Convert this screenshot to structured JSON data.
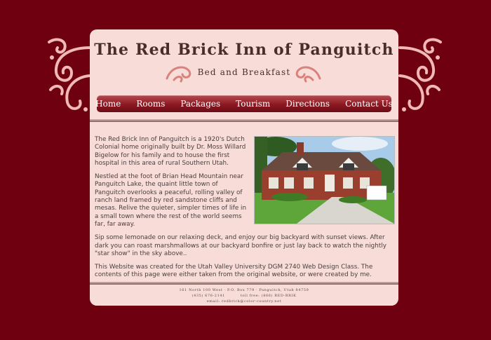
{
  "header": {
    "title": "The Red Brick Inn of Panguitch",
    "subtitle": "Bed and Breakfast"
  },
  "nav": {
    "items": [
      "Home",
      "Rooms",
      "Packages",
      "Tourism",
      "Directions",
      "Contact Us"
    ]
  },
  "main": {
    "paragraphs": [
      "The Red Brick Inn of Panguitch is a 1920's Dutch Colonial home originally built by Dr. Moss Willard Bigelow for his family and to house the first hospital in this area of rural Southern Utah.",
      "Nestled at the foot of Brian Head Mountain near Panguitch Lake, the quaint little town of Panguitch overlooks a peaceful, rolling valley of ranch land framed by red sandstone cliffs and mesas. Relive the quieter, simpler times of life in a small town where the rest of the world seems far, far away.",
      "Sip some lemonade on our relaxing deck, and enjoy our big backyard with sunset views. After dark you can roast marshmallows at our backyard bonfire or just lay back to watch the nightly \"star show\" in the sky above..",
      "This Website was created for the Utah Valley University DGM 2740 Web Design Class. The contents of this page were either taken from the original website, or were created by me."
    ]
  },
  "footer": {
    "address": "161 North 100 West · P.O. Box 779 · Panguitch, Utah 84759",
    "phone": "(435) 676-2141          toll free: (866) RED-BRIK",
    "email": "email: redbrick@color-country.net"
  },
  "colors": {
    "background": "#6e0010",
    "page": "#f7dcd8",
    "nav": "#8c1822",
    "text": "#4a3e3c"
  }
}
